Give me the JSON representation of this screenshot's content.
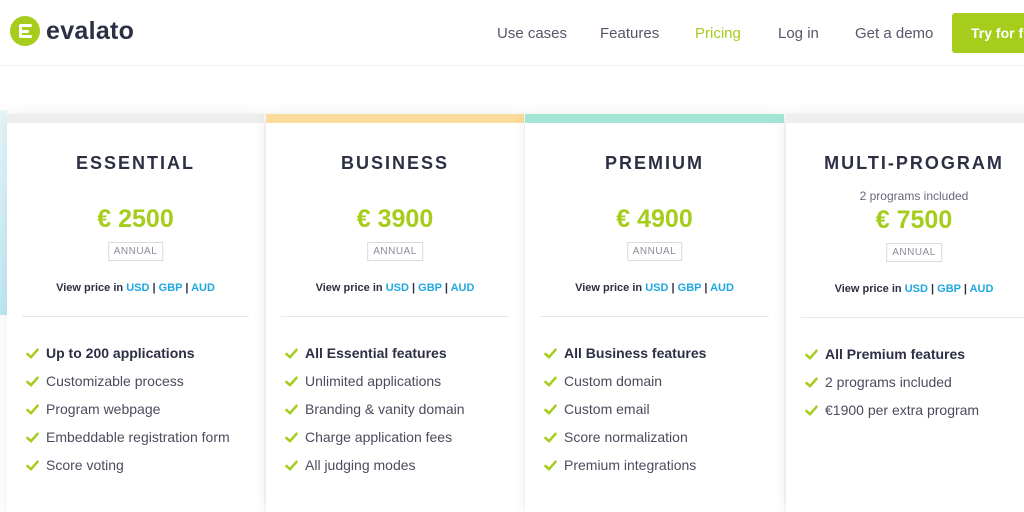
{
  "brand": {
    "name": "evalato",
    "color": "#a6cc1c"
  },
  "nav": {
    "items": [
      {
        "label": "Use cases"
      },
      {
        "label": "Features"
      },
      {
        "label": "Pricing",
        "active": true
      },
      {
        "label": "Log in"
      },
      {
        "label": "Get a demo"
      }
    ],
    "cta_label": "Try for free"
  },
  "plans": [
    {
      "name": "ESSENTIAL",
      "accent": "#eeeeee",
      "note": "",
      "price": "€ 2500",
      "billing": "ANNUAL",
      "view_price_label": "View price in",
      "currencies": [
        "USD",
        "GBP",
        "AUD"
      ],
      "features": [
        "Up to 200 applications",
        "Customizable process",
        "Program webpage",
        "Embeddable registration form",
        "Score voting"
      ]
    },
    {
      "name": "BUSINESS",
      "accent": "#fcdc9a",
      "note": "",
      "price": "€ 3900",
      "billing": "ANNUAL",
      "view_price_label": "View price in",
      "currencies": [
        "USD",
        "GBP",
        "AUD"
      ],
      "features": [
        "All Essential features",
        "Unlimited applications",
        "Branding & vanity domain",
        "Charge application fees",
        "All judging modes"
      ]
    },
    {
      "name": "PREMIUM",
      "accent": "#a4e6d6",
      "note": "",
      "price": "€ 4900",
      "billing": "ANNUAL",
      "view_price_label": "View price in",
      "currencies": [
        "USD",
        "GBP",
        "AUD"
      ],
      "features": [
        "All Business features",
        "Custom domain",
        "Custom email",
        "Score normalization",
        "Premium integrations"
      ]
    },
    {
      "name": "MULTI-PROGRAM",
      "accent": "#eeeeee",
      "note": "2 programs included",
      "price": "€ 7500",
      "billing": "ANNUAL",
      "view_price_label": "View price in",
      "currencies": [
        "USD",
        "GBP",
        "AUD"
      ],
      "features": [
        "All Premium features",
        "2 programs included",
        "€1900 per extra program"
      ]
    }
  ],
  "colors": {
    "accent_green": "#a6cc1c",
    "link_blue": "#1fa8e0",
    "text_dark": "#2d2f45"
  },
  "icons": {
    "feature_bullet": "check-icon",
    "logo": "evalato-logo-icon"
  }
}
